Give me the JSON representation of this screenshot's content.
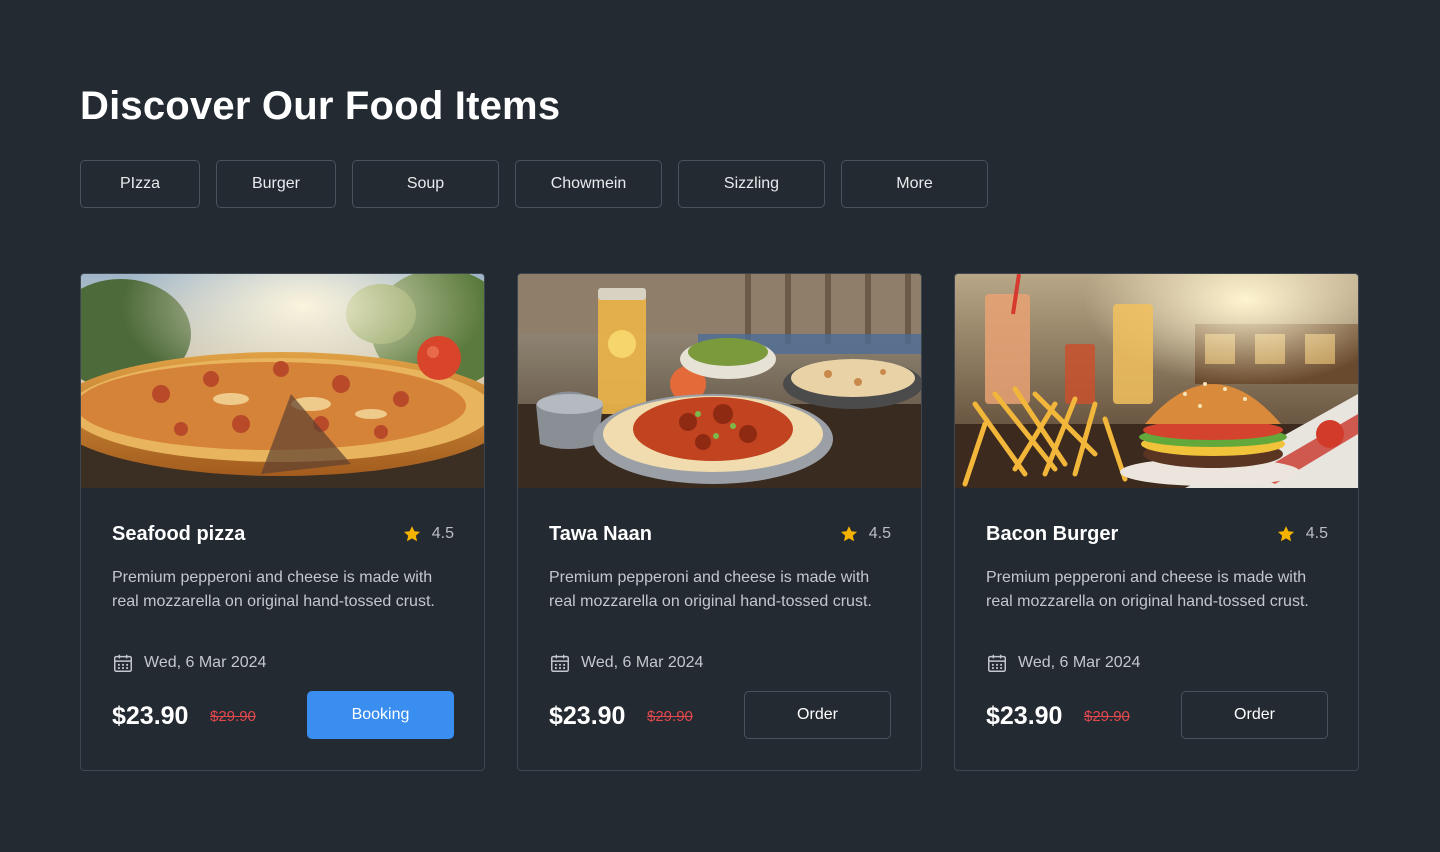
{
  "page": {
    "title": "Discover Our Food Items"
  },
  "categories": [
    {
      "label": "PIzza"
    },
    {
      "label": "Burger"
    },
    {
      "label": "Soup"
    },
    {
      "label": "Chowmein"
    },
    {
      "label": "Sizzling"
    },
    {
      "label": "More"
    }
  ],
  "colors": {
    "background": "#232a31",
    "accent": "#3a8ef0",
    "star": "#f5b301",
    "old_price": "#e0484e"
  },
  "cards": [
    {
      "image_icon": "pizza-photo",
      "title": "Seafood pizza",
      "rating": "4.5",
      "description": "Premium pepperoni and cheese is made with real mozzarella on original hand-tossed crust.",
      "date": "Wed, 6 Mar 2024",
      "price": "$23.90",
      "old_price": "$29.90",
      "action_label": "Booking",
      "action_style": "primary"
    },
    {
      "image_icon": "naan-curry-photo",
      "title": "Tawa Naan",
      "rating": "4.5",
      "description": "Premium pepperoni and cheese is made with real mozzarella on original hand-tossed crust.",
      "date": "Wed, 6 Mar 2024",
      "price": "$23.90",
      "old_price": "$29.90",
      "action_label": "Order",
      "action_style": "outline"
    },
    {
      "image_icon": "burger-fries-photo",
      "title": "Bacon Burger",
      "rating": "4.5",
      "description": "Premium pepperoni and cheese is made with real mozzarella on original hand-tossed crust.",
      "date": "Wed, 6 Mar 2024",
      "price": "$23.90",
      "old_price": "$29.90",
      "action_label": "Order",
      "action_style": "outline"
    }
  ]
}
